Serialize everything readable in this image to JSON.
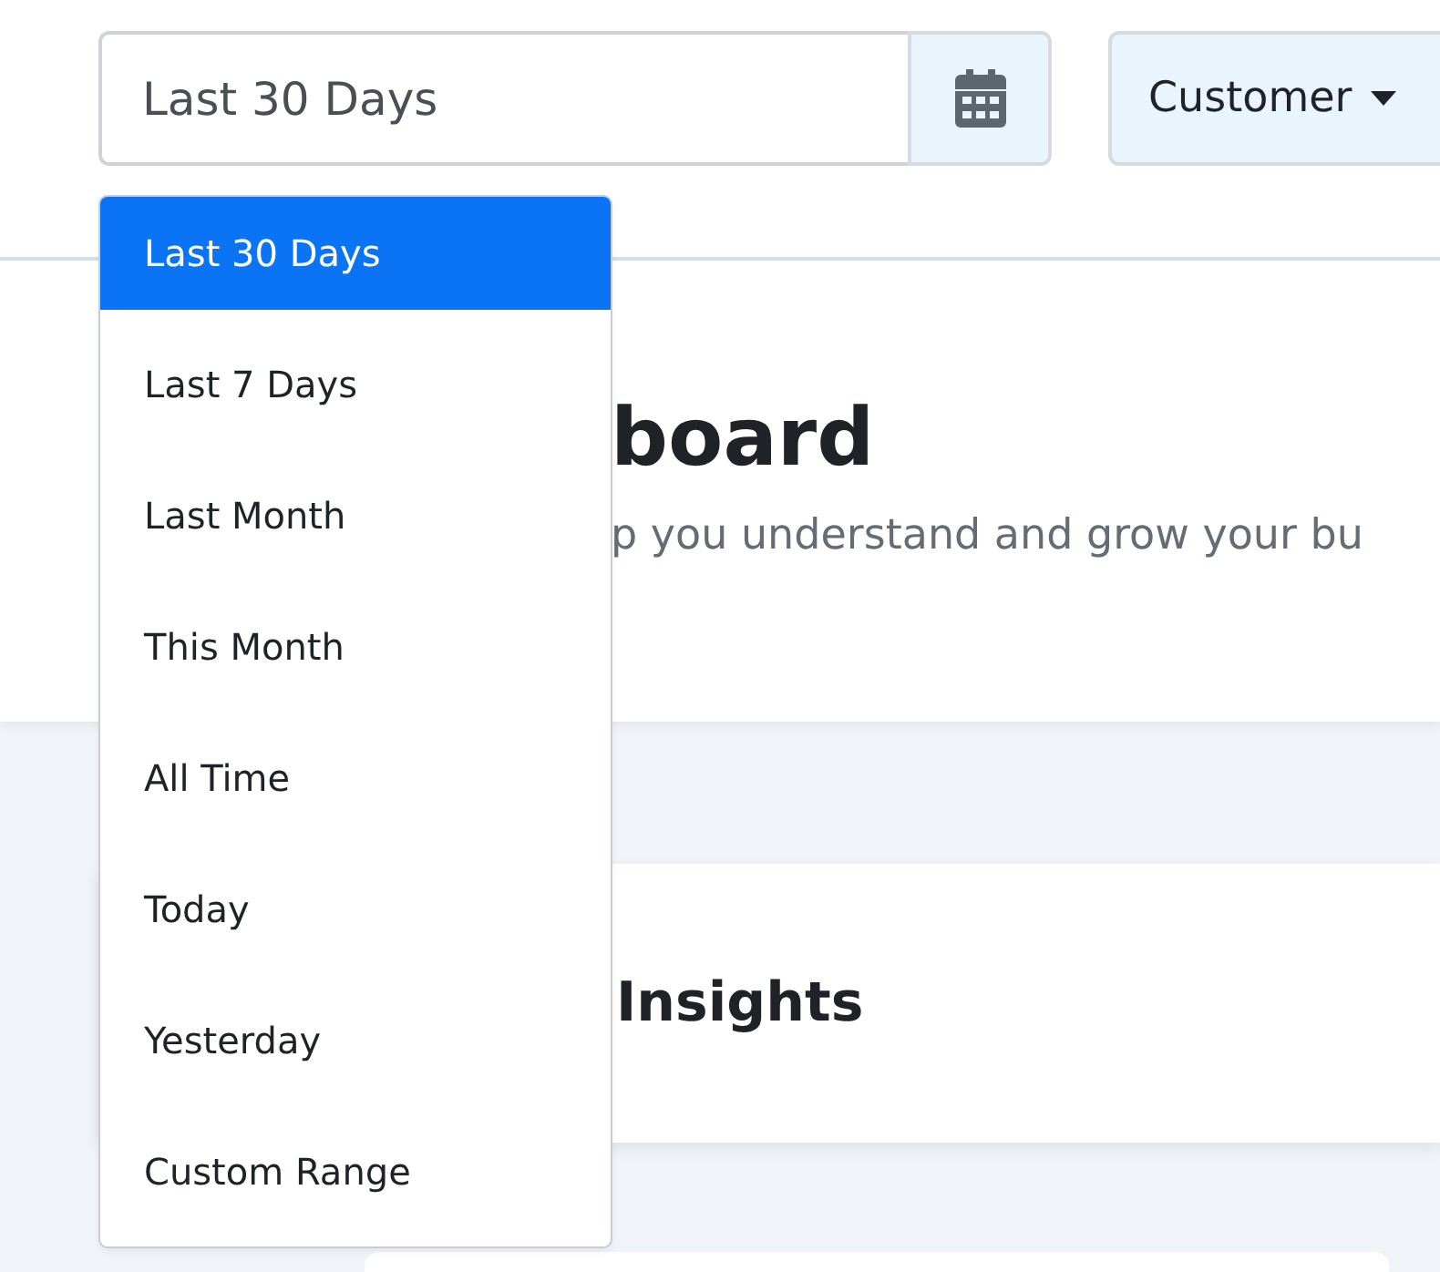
{
  "toolbar": {
    "date_field": {
      "value": "Last 30 Days"
    },
    "filter_button": {
      "label": "Customer"
    }
  },
  "date_menu": {
    "options": [
      {
        "label": "Last 30 Days",
        "selected": true
      },
      {
        "label": "Last 7 Days",
        "selected": false
      },
      {
        "label": "Last Month",
        "selected": false
      },
      {
        "label": "This Month",
        "selected": false
      },
      {
        "label": "All Time",
        "selected": false
      },
      {
        "label": "Today",
        "selected": false
      },
      {
        "label": "Yesterday",
        "selected": false
      },
      {
        "label": "Custom Range",
        "selected": false
      }
    ]
  },
  "header": {
    "title": "board",
    "subtitle": "p you understand and grow your bu"
  },
  "card": {
    "title": "Insights"
  }
}
